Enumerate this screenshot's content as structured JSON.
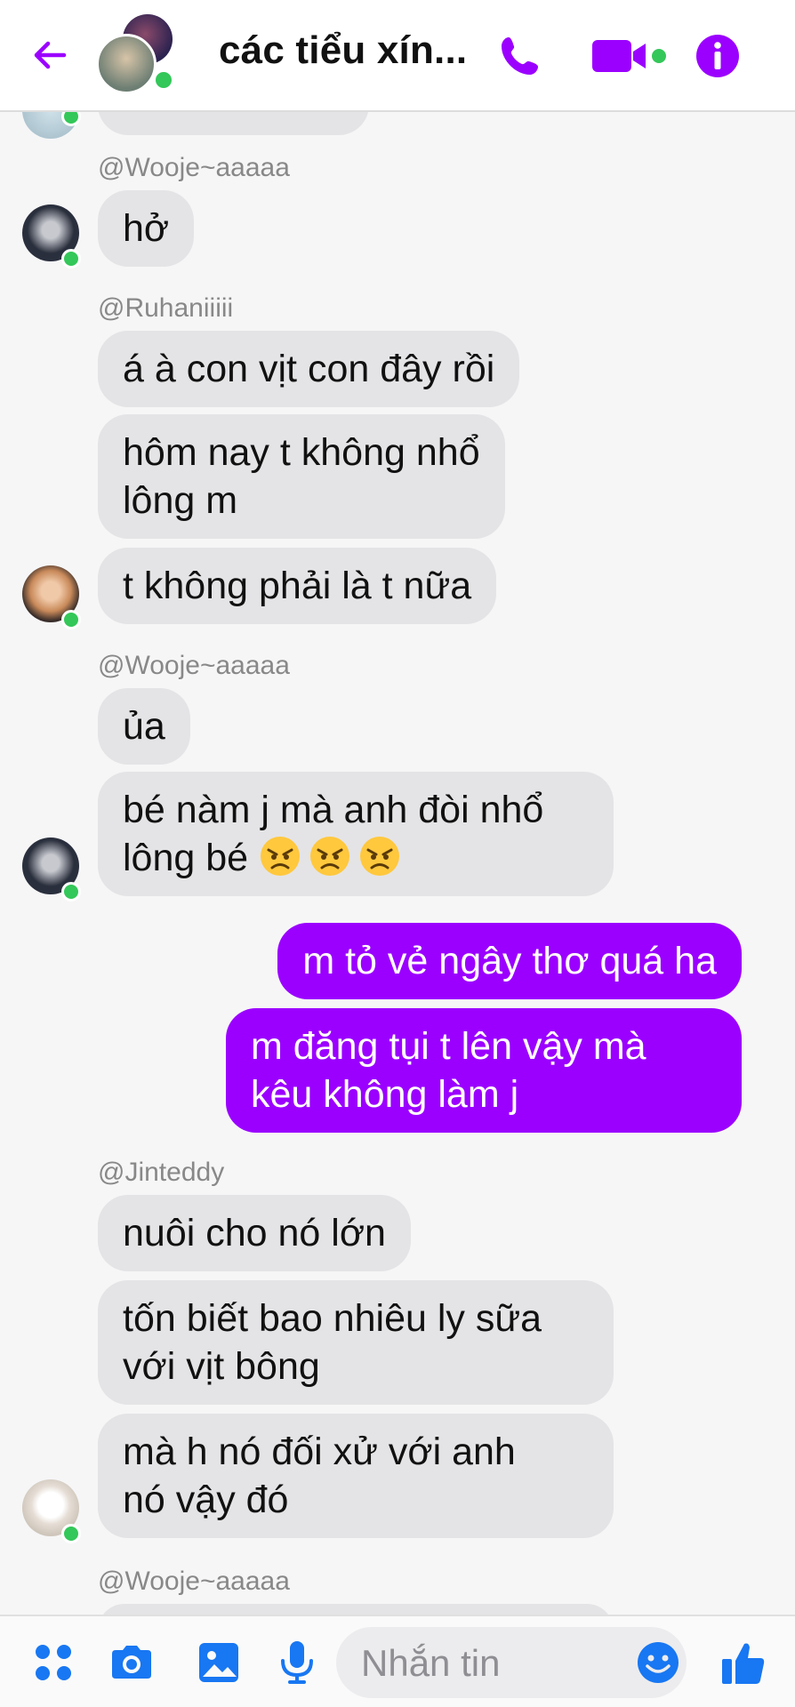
{
  "header": {
    "title": "các tiểu xín...",
    "icons": [
      "back-arrow-icon",
      "phone-icon",
      "video-camera-icon",
      "info-icon"
    ],
    "accent": "#9b00ff"
  },
  "messages": [
    {
      "sender": "@Wooje~aaaaa",
      "bubbles": [
        "hở"
      ]
    },
    {
      "sender": "@Ruhaniiiii",
      "bubbles": [
        "á à con vịt con đây rồi",
        "hôm nay t không nhổ\nlông m",
        "t không phải là t nữa"
      ]
    },
    {
      "sender": "@Wooje~aaaaa",
      "bubbles": [
        "ủa",
        "bé nàm j mà anh đòi nhổ\nlông bé"
      ],
      "emoji": [
        "angry-face",
        "angry-face",
        "angry-face"
      ]
    },
    {
      "sender": "me",
      "bubbles": [
        "m tỏ vẻ ngây thơ quá ha",
        "m đăng tụi t lên vậy mà\nkêu không làm j"
      ]
    },
    {
      "sender": "@Jinteddy",
      "bubbles": [
        "nuôi cho nó lớn",
        "tốn biết bao nhiêu ly sữa\nvới vịt bông",
        "mà h nó đối xử với anh\nnó vậy đó"
      ]
    },
    {
      "sender": "@Wooje~aaaaa",
      "bubbles": []
    }
  ],
  "composer": {
    "placeholder": "Nhắn tin",
    "icons": [
      "apps-icon",
      "camera-icon",
      "gallery-icon",
      "microphone-icon",
      "emoji-icon",
      "thumbs-up-icon"
    ]
  },
  "colors": {
    "bubble_other": "#e4e4e6",
    "bubble_me": "#9b00ff",
    "online": "#34c759"
  }
}
